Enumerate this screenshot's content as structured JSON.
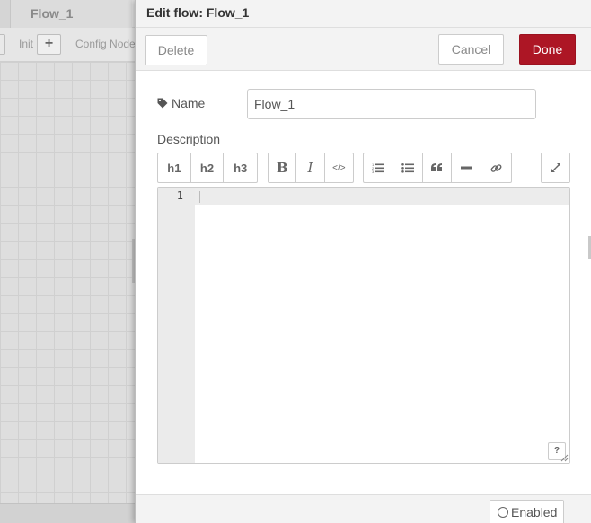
{
  "workspace": {
    "tab_label": "Flow_1",
    "toolbar_init_label": "Init",
    "toolbar_add_icon": "+",
    "toolbar_config_label": "Config Node"
  },
  "tray": {
    "title": "Edit flow: Flow_1",
    "delete_label": "Delete",
    "cancel_label": "Cancel",
    "done_label": "Done",
    "name_label": "Name",
    "name_value": "Flow_1",
    "description_label": "Description",
    "toolbar": {
      "h1": "h1",
      "h2": "h2",
      "h3": "h3",
      "bold": "B",
      "italic": "I",
      "code": "</>"
    },
    "editor_line_number": "1",
    "help_label": "?",
    "enabled_label": "Enabled"
  },
  "colors": {
    "done_button": "#ad1625",
    "workspace_bg": "#e6e6e6"
  }
}
